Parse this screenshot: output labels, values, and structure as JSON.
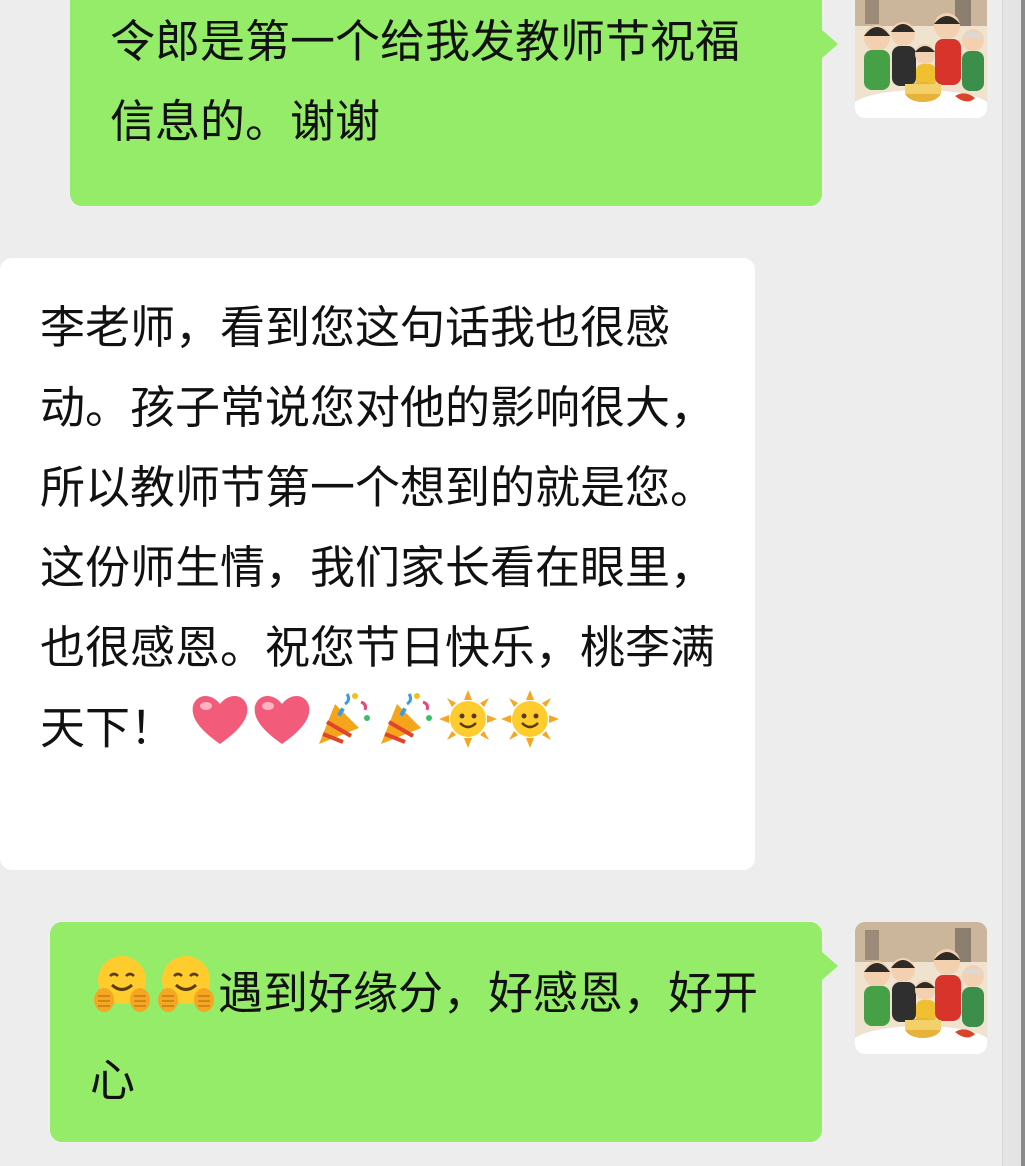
{
  "chat": {
    "messages": [
      {
        "direction": "sent",
        "text": "令郎是第一个给我发教师节祝福信息的。谢谢"
      },
      {
        "direction": "received",
        "text": "李老师，看到您这句话我也很感动。孩子常说您对他的影响很大，所以教师节第一个想到的就是您。这份师生情，我们家长看在眼里，也很感恩。祝您节日快乐，桃李满天下！",
        "emojis": [
          "heart-icon",
          "heart-icon",
          "party-popper-icon",
          "party-popper-icon",
          "sun-face-icon",
          "sun-face-icon"
        ]
      },
      {
        "direction": "sent",
        "lead_emojis": [
          "hugging-face-icon",
          "hugging-face-icon"
        ],
        "text": "遇到好缘分，好感恩，好开心"
      }
    ]
  },
  "colors": {
    "sent_bubble": "#95ec69",
    "received_bubble": "#ffffff",
    "background": "#ededed"
  }
}
